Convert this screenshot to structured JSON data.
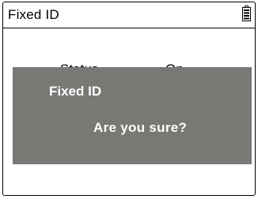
{
  "header": {
    "title": "Fixed ID",
    "battery_icon": "battery-icon"
  },
  "status_row": {
    "label": "Status",
    "value": "On"
  },
  "dialog": {
    "title": "Fixed ID",
    "message": "Are you sure?",
    "background_color": "#7a7875",
    "text_color": "#ffffff"
  }
}
